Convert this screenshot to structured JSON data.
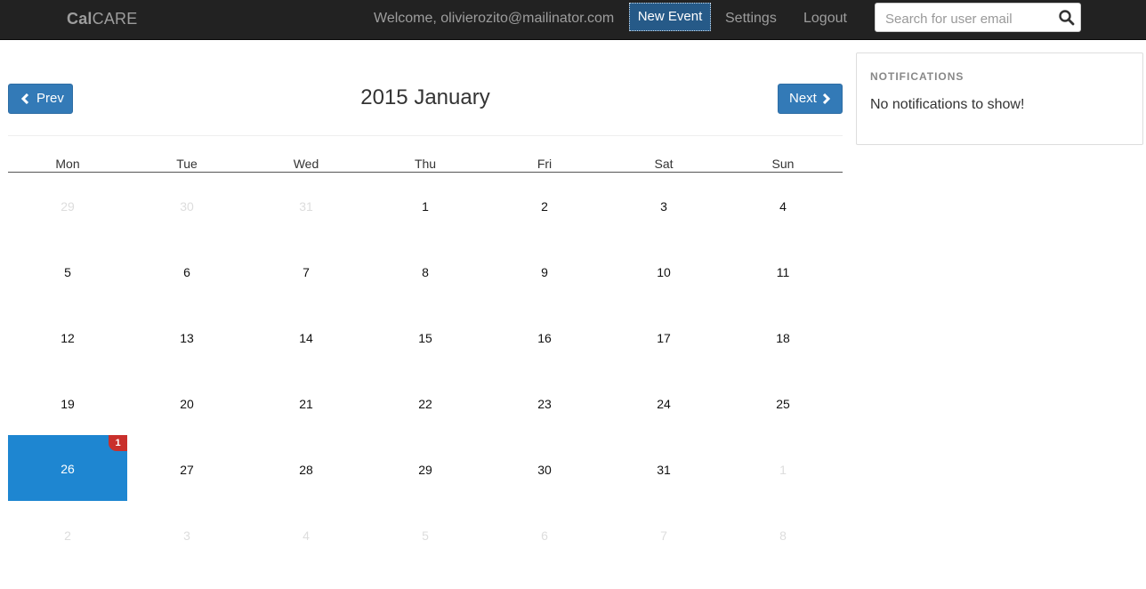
{
  "navbar": {
    "brand_bold": "Cal",
    "brand_rest": "CARE",
    "welcome": "Welcome, olivierozito@mailinator.com",
    "new_event": "New Event",
    "settings": "Settings",
    "logout": "Logout",
    "search_placeholder": "Search for user email"
  },
  "calendar": {
    "title": "2015 January",
    "prev_label": "Prev",
    "next_label": "Next",
    "weekdays": [
      "Mon",
      "Tue",
      "Wed",
      "Thu",
      "Fri",
      "Sat",
      "Sun"
    ],
    "weeks": [
      [
        {
          "day": "29",
          "muted": true
        },
        {
          "day": "30",
          "muted": true
        },
        {
          "day": "31",
          "muted": true
        },
        {
          "day": "1"
        },
        {
          "day": "2"
        },
        {
          "day": "3"
        },
        {
          "day": "4"
        }
      ],
      [
        {
          "day": "5"
        },
        {
          "day": "6"
        },
        {
          "day": "7"
        },
        {
          "day": "8"
        },
        {
          "day": "9"
        },
        {
          "day": "10"
        },
        {
          "day": "11"
        }
      ],
      [
        {
          "day": "12"
        },
        {
          "day": "13"
        },
        {
          "day": "14"
        },
        {
          "day": "15"
        },
        {
          "day": "16"
        },
        {
          "day": "17"
        },
        {
          "day": "18"
        }
      ],
      [
        {
          "day": "19"
        },
        {
          "day": "20"
        },
        {
          "day": "21"
        },
        {
          "day": "22"
        },
        {
          "day": "23"
        },
        {
          "day": "24"
        },
        {
          "day": "25"
        }
      ],
      [
        {
          "day": "26",
          "today": true,
          "badge": "1"
        },
        {
          "day": "27"
        },
        {
          "day": "28"
        },
        {
          "day": "29"
        },
        {
          "day": "30"
        },
        {
          "day": "31"
        },
        {
          "day": "1",
          "muted": true
        }
      ],
      [
        {
          "day": "2",
          "muted": true
        },
        {
          "day": "3",
          "muted": true
        },
        {
          "day": "4",
          "muted": true
        },
        {
          "day": "5",
          "muted": true
        },
        {
          "day": "6",
          "muted": true
        },
        {
          "day": "7",
          "muted": true
        },
        {
          "day": "8",
          "muted": true
        }
      ]
    ]
  },
  "notifications": {
    "title": "NOTIFICATIONS",
    "empty_message": "No notifications to show!"
  },
  "icons": {
    "search": "search-icon",
    "prev": "chevron-left-icon",
    "next": "chevron-right-icon"
  },
  "colors": {
    "navbar_bg": "#222222",
    "primary": "#337ab7",
    "today_bg": "#1e86d1",
    "badge_bg": "#c9302c"
  }
}
